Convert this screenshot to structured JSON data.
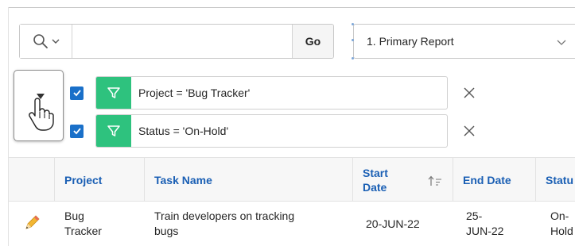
{
  "toolbar": {
    "search_value": "",
    "go_label": "Go",
    "report_selected": "1. Primary Report"
  },
  "filters": [
    {
      "label": "Project = 'Bug Tracker'",
      "checked": true
    },
    {
      "label": "Status = 'On-Hold'",
      "checked": true
    }
  ],
  "table": {
    "columns": [
      "Project",
      "Task Name",
      "Start Date",
      "End Date",
      "Status"
    ],
    "column_lines": {
      "project": [
        "Project"
      ],
      "task_name": [
        "Task Name"
      ],
      "start_date": [
        "Start",
        "Date"
      ],
      "end_date": [
        "End Date"
      ],
      "status": [
        "Statu"
      ]
    },
    "sort_column": "Start Date",
    "sort_direction": "ascending",
    "rows": [
      {
        "project": [
          "Bug",
          "Tracker"
        ],
        "task_name": [
          "Train developers on tracking",
          "bugs"
        ],
        "start_date": [
          "20-JUN-22"
        ],
        "end_date": [
          "25-",
          "JUN-22"
        ],
        "status": [
          "On-",
          "Hold"
        ]
      }
    ]
  },
  "colors": {
    "accent_blue": "#1a70c9",
    "link_blue": "#1a5fb4",
    "filter_green": "#2ec27e",
    "pencil_yellow": "#f2b632"
  }
}
